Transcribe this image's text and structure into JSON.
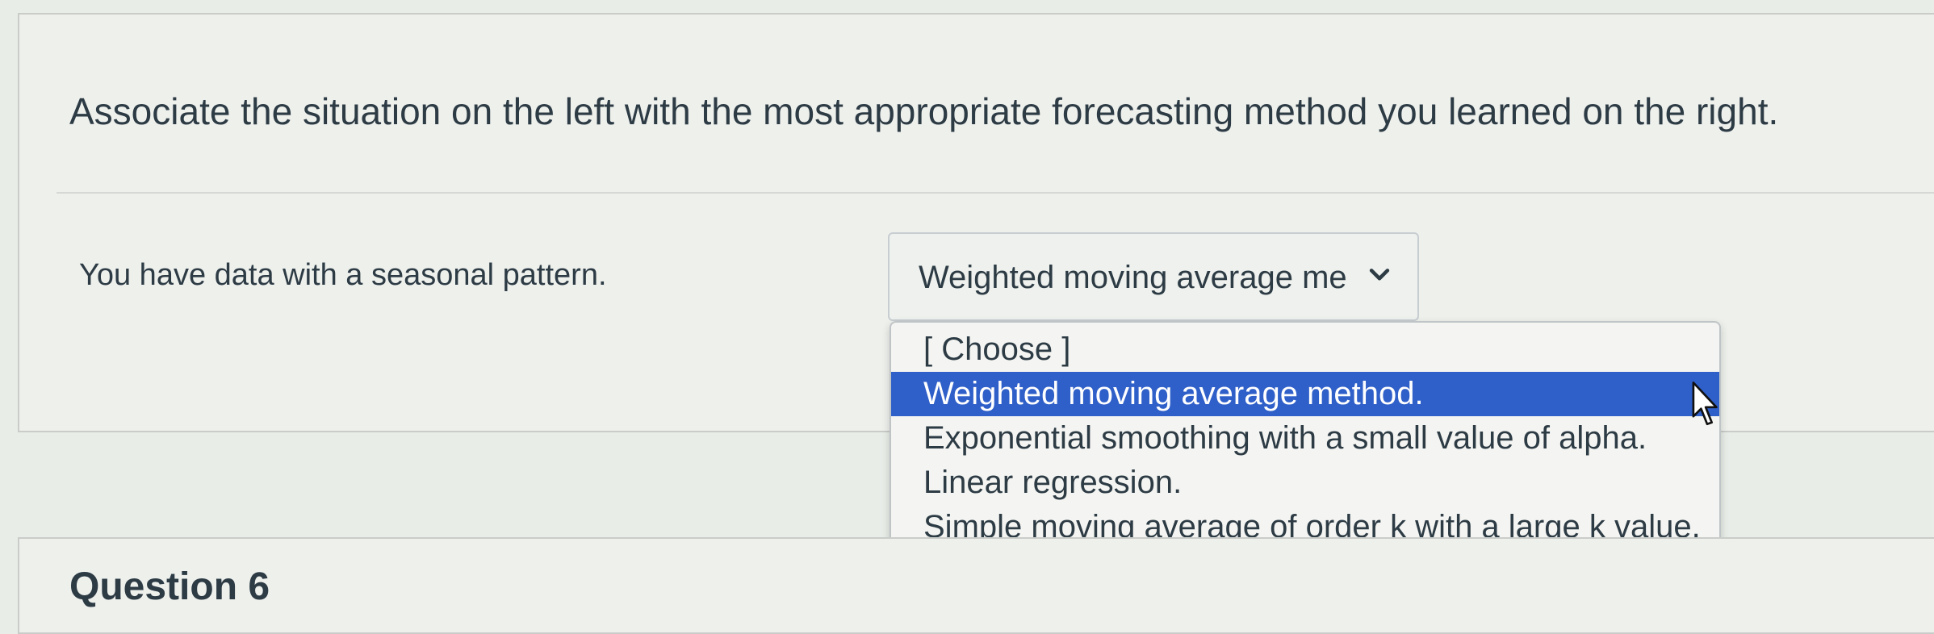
{
  "question": {
    "prompt": "Associate the situation on the left with the most appropriate forecasting method you learned on the right."
  },
  "match": {
    "situation": "You have data with a seasonal pattern.",
    "select": {
      "value": "Weighted moving average me",
      "icon": "chevron-down-icon",
      "options": [
        "[ Choose ]",
        "Weighted moving average method.",
        "Exponential smoothing with a small value of alpha.",
        "Linear regression.",
        "Simple moving average of order k with a large k value."
      ],
      "highlighted_index": 1
    }
  },
  "next_question": {
    "title": "Question 6"
  },
  "colors": {
    "highlight": "#2f5fc8",
    "text": "#2d3b45",
    "background": "#e9ede8"
  },
  "cursor": {
    "icon": "mouse-pointer-icon"
  }
}
